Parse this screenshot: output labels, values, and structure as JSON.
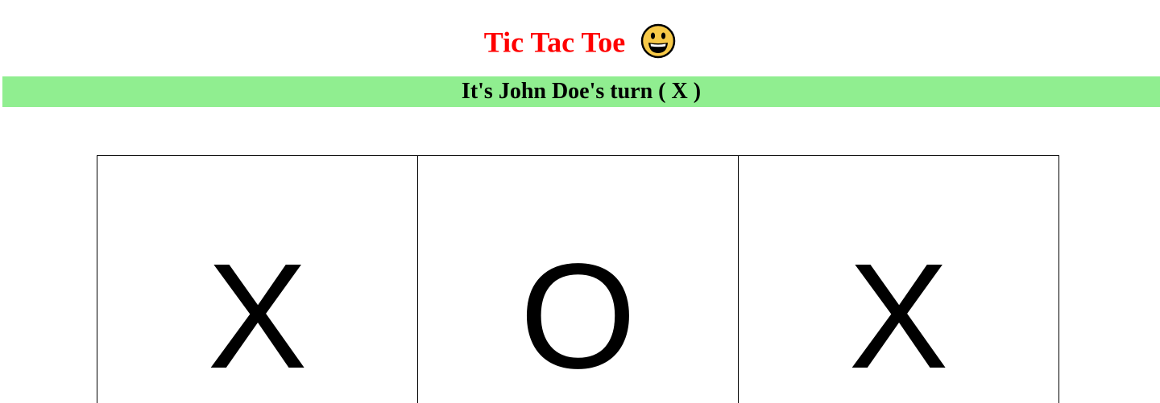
{
  "header": {
    "title": "Tic Tac Toe",
    "emoji_icon": "grinning-face-icon"
  },
  "status": {
    "text": "It's John Doe's turn ( X )",
    "background_color": "#90ee90"
  },
  "board": {
    "cells": [
      {
        "mark": "X"
      },
      {
        "mark": "O"
      },
      {
        "mark": "X"
      }
    ]
  },
  "colors": {
    "title": "#ff0000",
    "status_bar": "#90ee90"
  }
}
